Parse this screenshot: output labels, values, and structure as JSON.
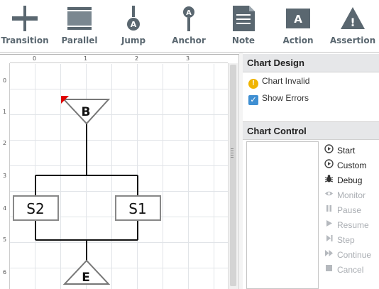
{
  "toolbar": {
    "items": [
      {
        "label": "Transition",
        "icon": "transition-icon"
      },
      {
        "label": "Parallel",
        "icon": "parallel-icon"
      },
      {
        "label": "Jump",
        "icon": "jump-icon",
        "badge": "A"
      },
      {
        "label": "Anchor",
        "icon": "anchor-icon",
        "badge": "A"
      },
      {
        "label": "Note",
        "icon": "note-icon"
      },
      {
        "label": "Action",
        "icon": "action-icon",
        "badge": "A"
      },
      {
        "label": "Assertion",
        "icon": "assertion-icon",
        "badge": "!"
      }
    ],
    "icon_color": "#5a6770"
  },
  "canvas": {
    "ruler_top": [
      "0",
      "1",
      "2",
      "3"
    ],
    "ruler_left": [
      "0",
      "1",
      "2",
      "3",
      "4",
      "5",
      "6"
    ],
    "begin_label": "B",
    "end_label": "E",
    "steps": [
      "S2",
      "S1"
    ]
  },
  "chart_design": {
    "title": "Chart Design",
    "status": "Chart Invalid",
    "show_errors_label": "Show Errors",
    "show_errors_checked": true
  },
  "chart_control": {
    "title": "Chart Control",
    "buttons": [
      {
        "label": "Start",
        "icon": "play-circle-icon",
        "enabled": true
      },
      {
        "label": "Custom",
        "icon": "play-circle-icon",
        "enabled": true
      },
      {
        "label": "Debug",
        "icon": "bug-icon",
        "enabled": true
      },
      {
        "label": "Monitor",
        "icon": "eye-icon",
        "enabled": false
      },
      {
        "label": "Pause",
        "icon": "pause-icon",
        "enabled": false
      },
      {
        "label": "Resume",
        "icon": "play-icon",
        "enabled": false
      },
      {
        "label": "Step",
        "icon": "step-icon",
        "enabled": false
      },
      {
        "label": "Continue",
        "icon": "fast-forward-icon",
        "enabled": false
      },
      {
        "label": "Cancel",
        "icon": "stop-icon",
        "enabled": false
      }
    ]
  }
}
